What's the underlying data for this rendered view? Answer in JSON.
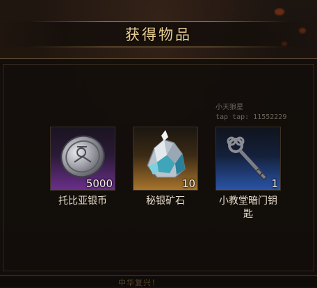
{
  "dialog": {
    "title": "获得物品"
  },
  "watermark": {
    "line1": "小天狼星",
    "line2": "tap tap: 11552229"
  },
  "items": [
    {
      "name": "托比亚银币",
      "count": "5000",
      "icon": "silver-coin-icon",
      "rarity_color": "#6a2f8a"
    },
    {
      "name": "秘银矿石",
      "count": "10",
      "icon": "mithril-ore-icon",
      "rarity_color": "#a8742c"
    },
    {
      "name": "小教堂暗门钥匙",
      "count": "1",
      "icon": "key-icon",
      "rarity_color": "#2a54a8"
    }
  ],
  "background": {
    "faded_text": "中华复兴！"
  }
}
